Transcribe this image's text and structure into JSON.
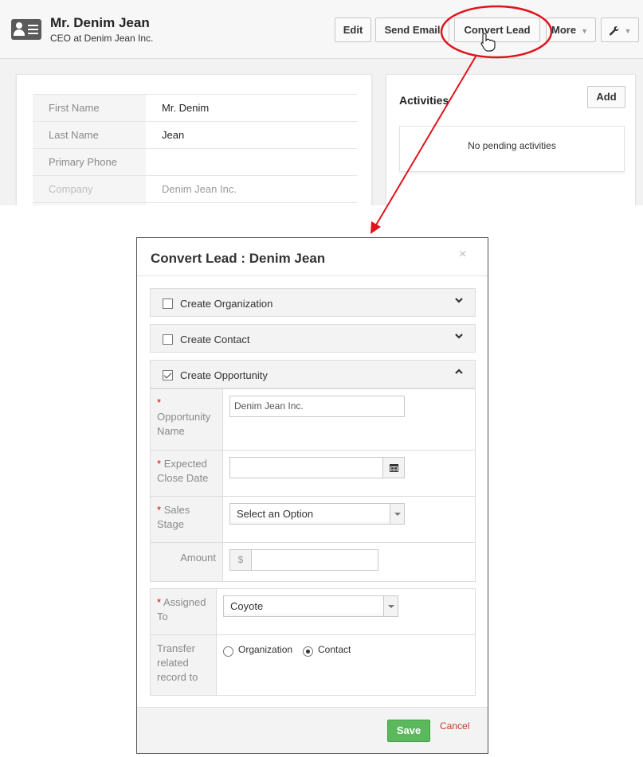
{
  "lead": {
    "name": "Mr. Denim Jean",
    "subtitle": "CEO at Denim Jean Inc."
  },
  "header_buttons": {
    "edit": "Edit",
    "send_email": "Send Email",
    "convert_lead": "Convert Lead",
    "more": "More",
    "caret": "▼"
  },
  "details": [
    {
      "label": "First Name",
      "value": "Mr. Denim"
    },
    {
      "label": "Last Name",
      "value": "Jean"
    },
    {
      "label": "Primary Phone",
      "value": ""
    },
    {
      "label": "Company",
      "value": "Denim Jean Inc."
    }
  ],
  "activities": {
    "title": "Activities",
    "add_label": "Add",
    "empty_text": "No pending activities"
  },
  "modal": {
    "title": "Convert Lead : Denim Jean",
    "close": "×",
    "sections": {
      "organization": {
        "label": "Create Organization",
        "checked": false
      },
      "contact": {
        "label": "Create Contact",
        "checked": false
      },
      "opportunity": {
        "label": "Create Opportunity",
        "checked": true
      }
    },
    "opportunity_fields": {
      "required_mark": "*",
      "name_label": "Opportunity Name",
      "name_value": "Denim Jean Inc.",
      "close_date_label": "Expected Close Date",
      "close_date_value": "",
      "sales_stage_label": "Sales Stage",
      "sales_stage_value": "Select an Option",
      "amount_label": "Amount",
      "amount_prefix": "$",
      "amount_value": ""
    },
    "assignment": {
      "assigned_label": "Assigned To",
      "assigned_value": "Coyote",
      "transfer_label": "Transfer related record to",
      "options": [
        "Organization",
        "Contact"
      ],
      "selected": "Contact"
    },
    "footer": {
      "save": "Save",
      "cancel": "Cancel"
    }
  },
  "colors": {
    "annotation": "#e0141c",
    "save": "#5cb85c",
    "required": "#dd0000"
  }
}
